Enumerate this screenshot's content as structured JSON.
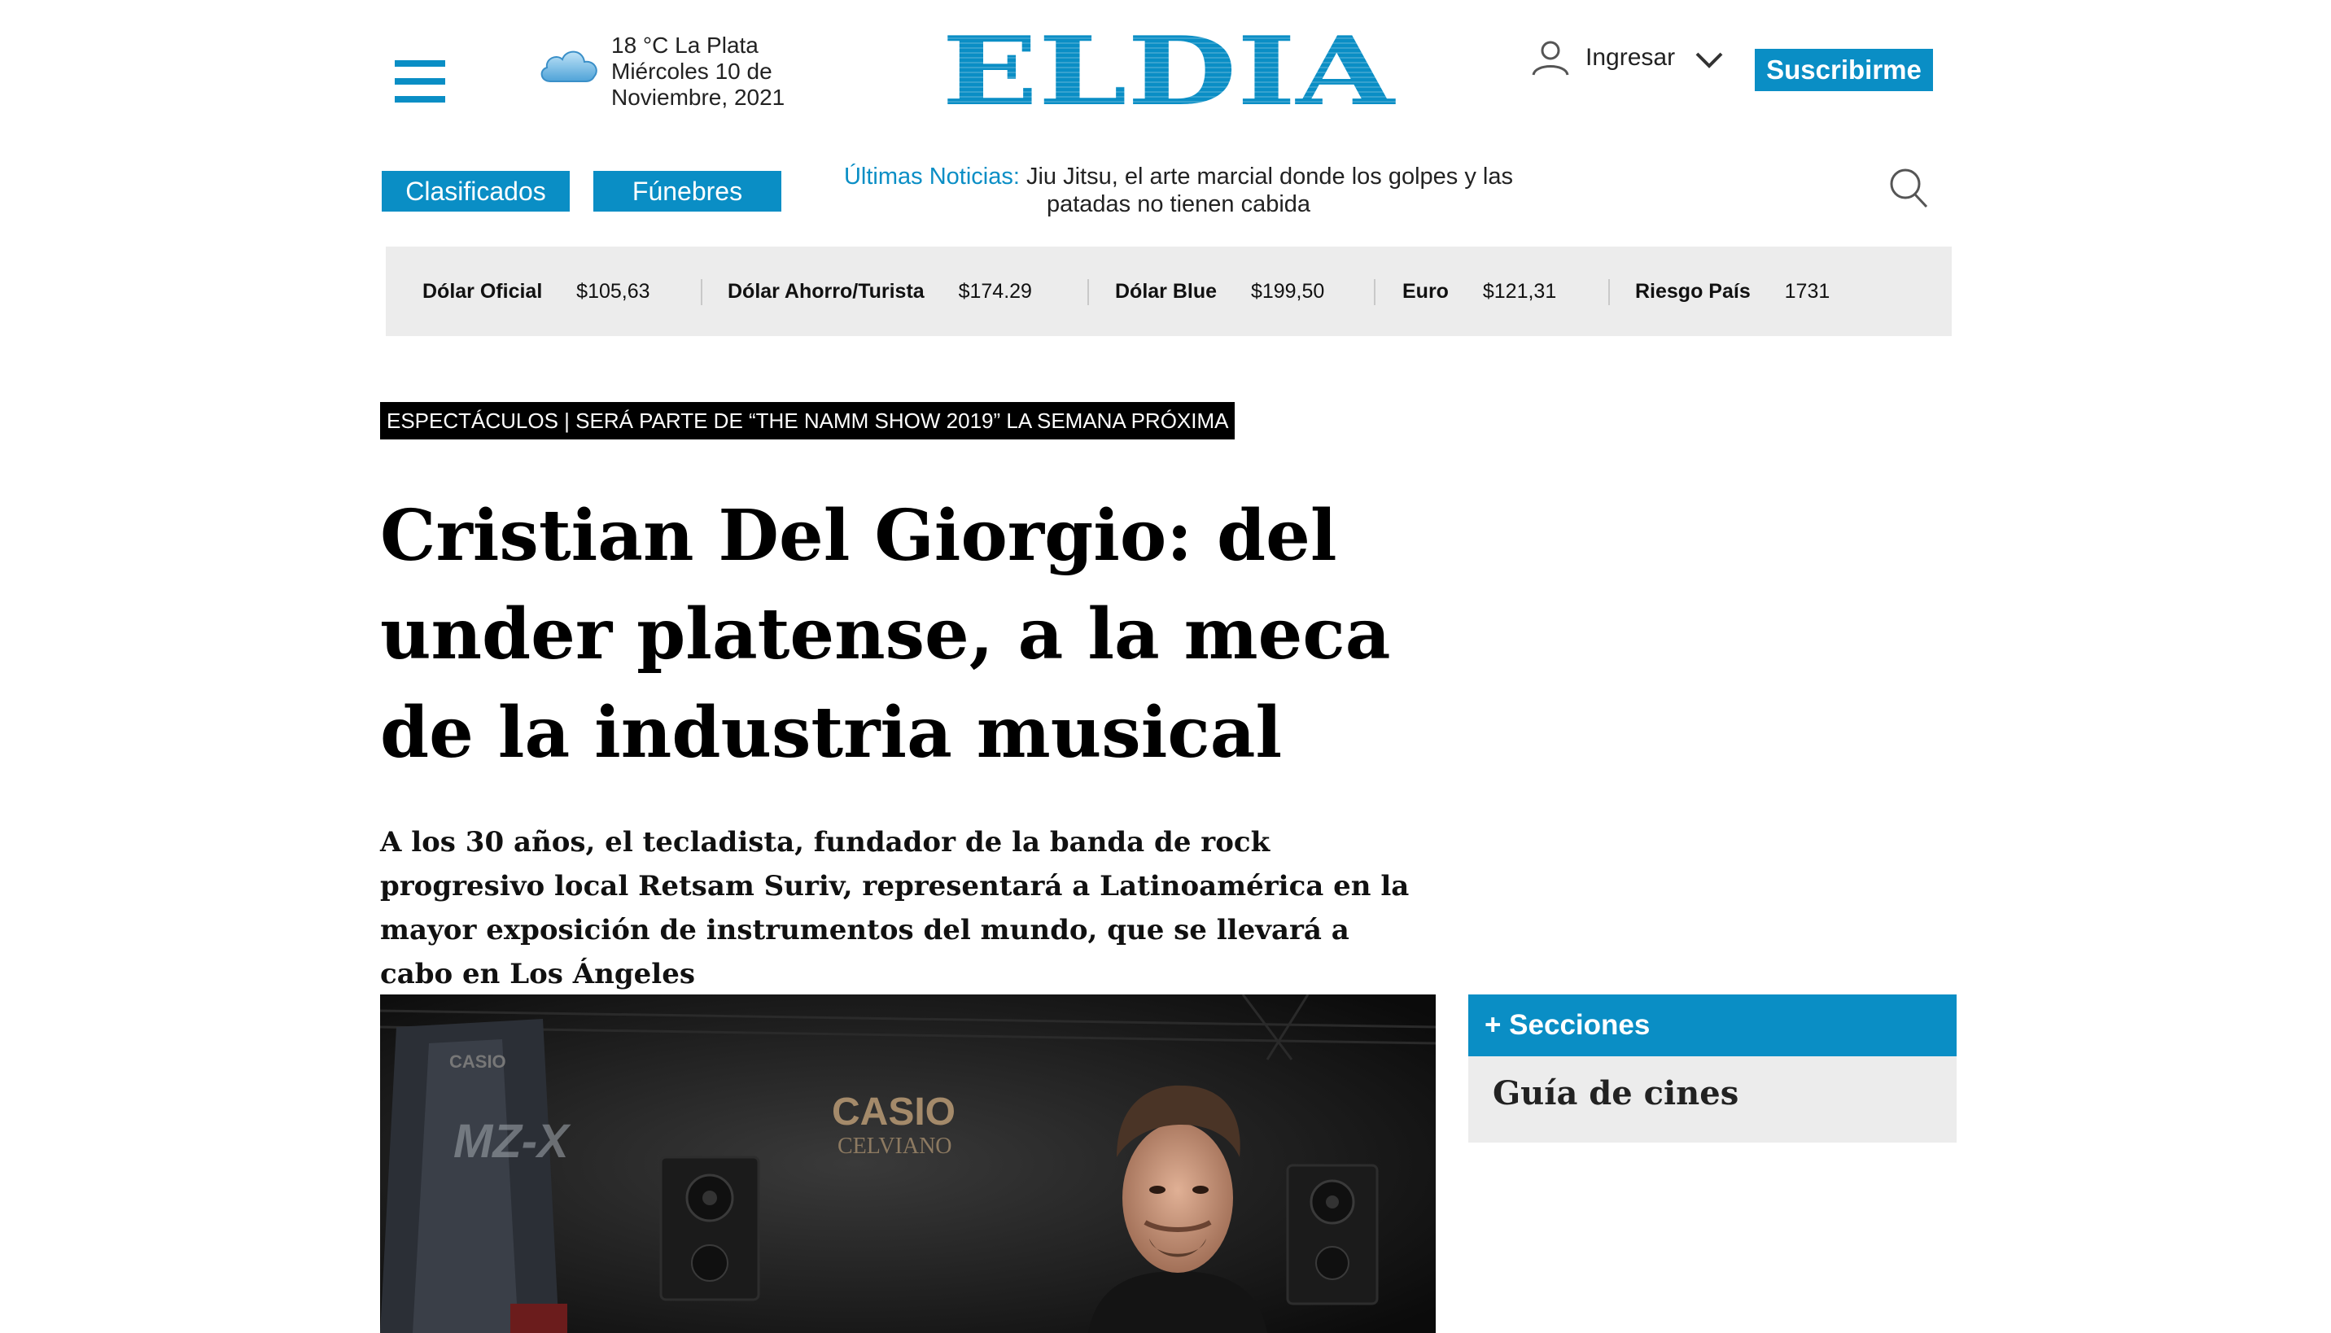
{
  "header": {
    "weather": {
      "icon": "cloud-icon",
      "line1": "18 °C La Plata",
      "line2": "Miércoles 10 de",
      "line3": "Noviembre, 2021"
    },
    "logo_text": "ELDIA",
    "login_label": "Ingresar",
    "subscribe_label": "Suscribirme",
    "brand_color": "#0a8ec5"
  },
  "nav": {
    "clasificados_label": "Clasificados",
    "funebres_label": "Fúnebres",
    "ticker_label": "Últimas Noticias:",
    "ticker_text": "Jiu Jitsu, el arte marcial donde los golpes y las patadas no tienen cabida"
  },
  "currency": [
    {
      "name": "Dólar Oficial",
      "value": "$105,63"
    },
    {
      "name": "Dólar Ahorro/Turista",
      "value": "$174.29"
    },
    {
      "name": "Dólar Blue",
      "value": "$199,50"
    },
    {
      "name": "Euro",
      "value": "$121,31"
    },
    {
      "name": "Riesgo País",
      "value": "1731"
    }
  ],
  "article": {
    "kicker": "ESPECTÁCULOS | SERÁ PARTE DE “THE NAMM SHOW 2019” LA SEMANA PRÓXIMA",
    "headline": "Cristian Del Giorgio: del under platense, a la meca de la industria musical",
    "lead": "A los 30 años, el tecladista, fundador de la banda de rock progresivo local Retsam Suriv, representará a Latinoamérica en la mayor exposición de instrumentos del mundo, que se llevará a cabo en Los Ángeles",
    "photo": {
      "brand_texts": [
        "CASIO",
        "MZ-X",
        "CASIO",
        "CELVIANO"
      ]
    }
  },
  "sidebar": {
    "sections_label": "+ Secciones",
    "link_label": "Guía de cines"
  }
}
